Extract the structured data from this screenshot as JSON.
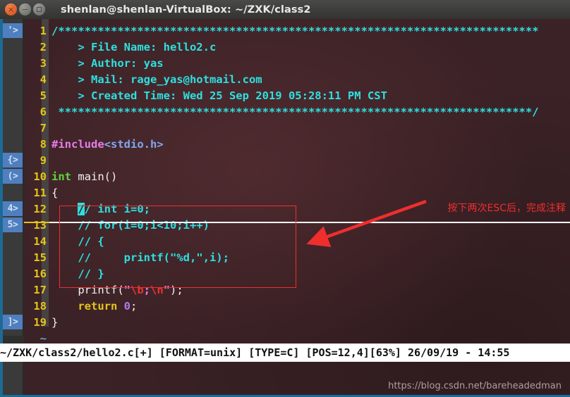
{
  "window": {
    "title": "shenlan@shenlan-VirtualBox: ~/ZXK/class2",
    "close_glyph": "×",
    "minimize_glyph": "−",
    "maximize_glyph": ""
  },
  "editor": {
    "marks": [
      {
        "label": "'>",
        "line": 1
      },
      {
        "label": "{>",
        "line": 9
      },
      {
        "label": "(>",
        "line": 10
      },
      {
        "label": "4>",
        "line": 12
      },
      {
        "label": "5>",
        "line": 13
      },
      {
        "label": "]>",
        "line": 19
      }
    ],
    "lines": [
      {
        "num": "1",
        "text": "/*************************************************************************"
      },
      {
        "num": "2",
        "text": "    > File Name: hello2.c"
      },
      {
        "num": "3",
        "text": "    > Author: yas"
      },
      {
        "num": "4",
        "text": "    > Mail: rage_yas@hotmail.com"
      },
      {
        "num": "5",
        "text": "    > Created Time: Wed 25 Sep 2019 05:28:11 PM CST"
      },
      {
        "num": "6",
        "text": " ************************************************************************/"
      },
      {
        "num": "7",
        "text": ""
      },
      {
        "num": "8",
        "text": "#include<stdio.h>"
      },
      {
        "num": "9",
        "text": ""
      },
      {
        "num": "10",
        "text": "int main()"
      },
      {
        "num": "11",
        "text": "{"
      },
      {
        "num": "12",
        "text": "    // int i=0;"
      },
      {
        "num": "13",
        "text": "    // for(i=0;i<10;i++)"
      },
      {
        "num": "14",
        "text": "    // {"
      },
      {
        "num": "15",
        "text": "    //     printf(\"%d,\",i);"
      },
      {
        "num": "16",
        "text": "    // }"
      },
      {
        "num": "17",
        "text": "    printf(\"\\b;\\n\");"
      },
      {
        "num": "18",
        "text": "    return 0;"
      },
      {
        "num": "19",
        "text": "}"
      }
    ],
    "tildes": [
      "~",
      "~"
    ],
    "cursor_line": "12",
    "cursor_char": "/"
  },
  "annotation": {
    "text": "按下两次ESC后，完成注释",
    "color": "#ef2e2e"
  },
  "statusline": {
    "text": "~/ZXK/class2/hello2.c[+] [FORMAT=unix] [TYPE=C] [POS=12,4][63%] 26/09/19 - 14:55",
    "file": "~/ZXK/class2/hello2.c[+]",
    "format": "[FORMAT=unix]",
    "type": "[TYPE=C]",
    "pos": "[POS=12,4]",
    "percent": "[63%]",
    "date": "26/09/19",
    "time": "14:55"
  },
  "watermark": {
    "text": "https://blog.csdn.net/bareheadedman"
  },
  "colors": {
    "terminal_bg": "#3b2226",
    "comment": "#2ee0e0",
    "linenum": "#e5c419",
    "preproc": "#e87ce8",
    "type": "#5fd63a",
    "string": "#e87ce8",
    "escape": "#f03030",
    "keyword": "#e5c419",
    "number": "#b07ce8",
    "annotation": "#ef2e2e",
    "mark_bg": "#4f7fbf",
    "status_bg": "#ffffff"
  }
}
